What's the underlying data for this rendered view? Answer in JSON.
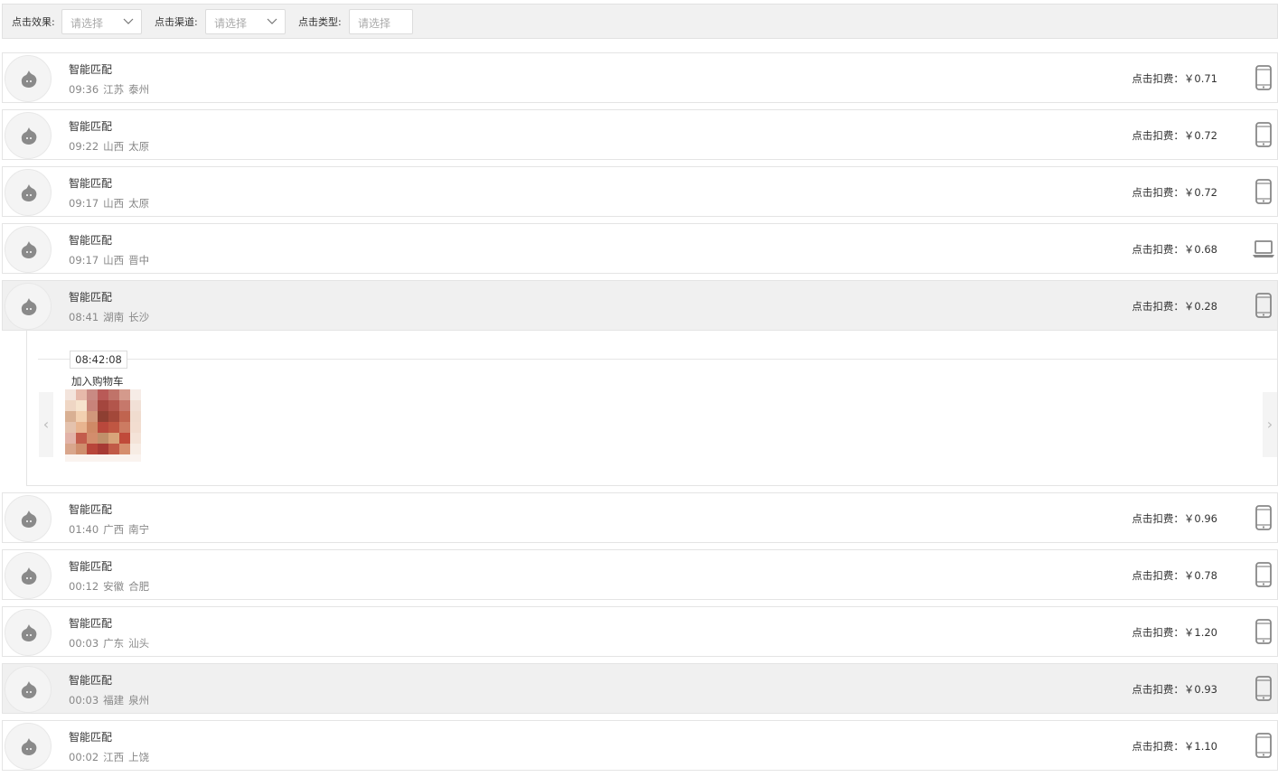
{
  "filters": {
    "effect": {
      "label": "点击效果:",
      "placeholder": "请选择"
    },
    "channel": {
      "label": "点击渠道:",
      "placeholder": "请选择"
    },
    "type": {
      "label": "点击类型:",
      "placeholder": "请选择"
    }
  },
  "rows": [
    {
      "title": "智能匹配",
      "time": "09:36",
      "province": "江苏",
      "city": "泰州",
      "cost": "点击扣费：￥0.71",
      "device": "phone-icon"
    },
    {
      "title": "智能匹配",
      "time": "09:22",
      "province": "山西",
      "city": "太原",
      "cost": "点击扣费：￥0.72",
      "device": "phone-icon"
    },
    {
      "title": "智能匹配",
      "time": "09:17",
      "province": "山西",
      "city": "太原",
      "cost": "点击扣费：￥0.72",
      "device": "phone-icon"
    },
    {
      "title": "智能匹配",
      "time": "09:17",
      "province": "山西",
      "city": "晋中",
      "cost": "点击扣费：￥0.68",
      "device": "laptop-icon"
    },
    {
      "title": "智能匹配",
      "time": "08:41",
      "province": "湖南",
      "city": "长沙",
      "cost": "点击扣费：￥0.28",
      "device": "phone-icon"
    },
    {
      "title": "智能匹配",
      "time": "01:40",
      "province": "广西",
      "city": "南宁",
      "cost": "点击扣费：￥0.96",
      "device": "phone-icon"
    },
    {
      "title": "智能匹配",
      "time": "00:12",
      "province": "安徽",
      "city": "合肥",
      "cost": "点击扣费：￥0.78",
      "device": "phone-icon"
    },
    {
      "title": "智能匹配",
      "time": "00:03",
      "province": "广东",
      "city": "汕头",
      "cost": "点击扣费：￥1.20",
      "device": "phone-icon"
    },
    {
      "title": "智能匹配",
      "time": "00:03",
      "province": "福建",
      "city": "泉州",
      "cost": "点击扣费：￥0.93",
      "device": "phone-icon"
    },
    {
      "title": "智能匹配",
      "time": "00:02",
      "province": "江西",
      "city": "上饶",
      "cost": "点击扣费：￥1.10",
      "device": "phone-icon"
    }
  ],
  "detail": {
    "time": "08:42:08",
    "event": "加入购物车",
    "prev_icon": "chevron-left-icon",
    "next_icon": "chevron-right-icon",
    "nav_prev": "‹",
    "nav_next": "›"
  },
  "colors": {
    "highlight_row": "#f0f0f0",
    "border": "#e4e4e4",
    "muted_text": "#888888"
  }
}
